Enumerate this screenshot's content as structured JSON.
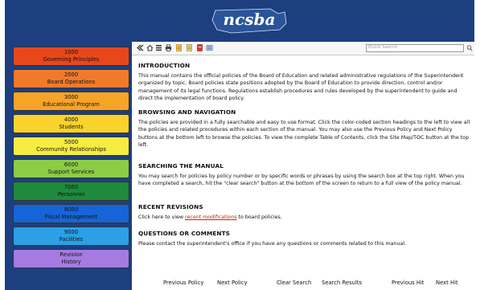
{
  "header": {
    "logo_text": "ncsba"
  },
  "sections": [
    {
      "num": "1000",
      "label": "Governing Principles",
      "color": "#e8471c"
    },
    {
      "num": "2000",
      "label": "Board Operations",
      "color": "#f17a2a"
    },
    {
      "num": "3000",
      "label": "Educational Program",
      "color": "#f6a426"
    },
    {
      "num": "4000",
      "label": "Students",
      "color": "#f9d32c"
    },
    {
      "num": "5000",
      "label": "Community Relationships",
      "color": "#f6ec42"
    },
    {
      "num": "6000",
      "label": "Support Services",
      "color": "#8dcc45"
    },
    {
      "num": "7000",
      "label": "Personnel",
      "color": "#1e8a3c"
    },
    {
      "num": "8000",
      "label": "Fiscal Management",
      "color": "#1565d8"
    },
    {
      "num": "9000",
      "label": "Facilities",
      "color": "#2ba0e6"
    },
    {
      "num": "Revision",
      "label": "History",
      "color": "#a57be2"
    }
  ],
  "toolbar": {
    "icons": [
      "collapse-icon",
      "home-icon",
      "sitemap-icon",
      "print-icon",
      "pdf-icon",
      "document-icon",
      "bookmark-icon",
      "email-icon"
    ],
    "search_placeholder": "Quick Search"
  },
  "content": {
    "intro_heading": "INTRODUCTION",
    "intro_text": "This manual contains the official policies of the Board of Education and related administrative regulations of the Superintendent organized by topic. Board policies state positions adopted by the Board of Education to provide direction, control and/or management of its legal functions. Regulations establish procedures and rules developed by the superintendent to guide and direct the implementation of board policy.",
    "browse_heading": "BROWSING AND NAVIGATION",
    "browse_text": "The policies are provided in a fully searchable and easy to use format. Click the color-coded section headings to the left to view all the policies and related procedures within each section of the manual. You may also use the Previous Policy and Next Policy buttons at the bottom left to browse the policies. To view the complete Table of Contents, click the Site Map/TOC button at the top left.",
    "search_heading": "SEARCHING THE MANUAL",
    "search_text": "You may search for policies by policy number or by specific words or phrases by using the search box at the top right. When you have completed a search, hit the \"clear search\" button at the bottom of the screen to return to a full view of the policy manual.",
    "revisions_heading": "RECENT REVISIONS",
    "revisions_prefix": "Click here to view ",
    "revisions_link": "recent modifications",
    "revisions_suffix": " to board policies.",
    "questions_heading": "QUESTIONS OR COMMENTS",
    "questions_text": "Please contact the superintendent's office if you have any questions or comments related to this manual."
  },
  "footer": {
    "prev_policy": "Previous Policy",
    "next_policy": "Next Policy",
    "clear_search": "Clear Search",
    "search_results": "Search Results",
    "prev_hit": "Previous Hit",
    "next_hit": "Next Hit"
  },
  "colors": {
    "brand": "#1d3f7f",
    "link": "#cc2200"
  }
}
